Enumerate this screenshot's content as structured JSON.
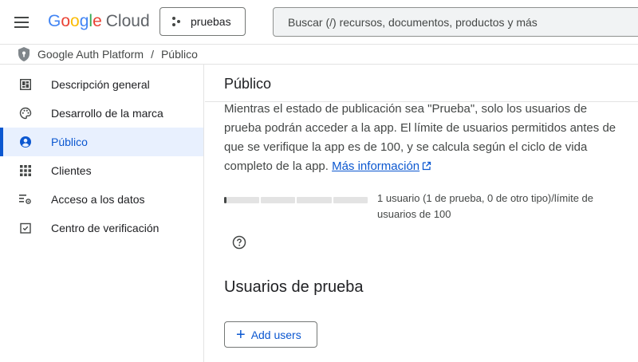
{
  "header": {
    "logo": {
      "google": "Google",
      "cloud": "Cloud"
    },
    "project": "pruebas",
    "search_placeholder": "Buscar (/) recursos, documentos, productos y más"
  },
  "breadcrumb": {
    "items": [
      "Google Auth Platform",
      "Público"
    ],
    "separator": "/"
  },
  "sidebar": {
    "items": [
      {
        "label": "Descripción general",
        "icon": "dashboard-icon"
      },
      {
        "label": "Desarrollo de la marca",
        "icon": "palette-icon"
      },
      {
        "label": "Público",
        "icon": "person-icon",
        "active": true
      },
      {
        "label": "Clientes",
        "icon": "grid-icon"
      },
      {
        "label": "Acceso a los datos",
        "icon": "data-access-icon"
      },
      {
        "label": "Centro de verificación",
        "icon": "verified-icon"
      }
    ]
  },
  "main": {
    "title": "Público",
    "description": "Mientras el estado de publicación sea \"Prueba\", solo los usuarios de prueba podrán acceder a la app. El límite de usuarios permitidos antes de que se verifique la app es de 100, y se calcula según el ciclo de vida completo de la app.",
    "learn_more": "Más información",
    "usage": {
      "text": "1 usuario (1 de prueba, 0 de otro tipo)/límite de usuarios de 100",
      "used": 1,
      "limit": 100
    },
    "test_users_title": "Usuarios de prueba",
    "add_users_label": "Add users"
  },
  "colors": {
    "accent": "#0b57d0",
    "active_bg": "#e8f0fe",
    "text": "#202124",
    "secondary_text": "#444746"
  }
}
